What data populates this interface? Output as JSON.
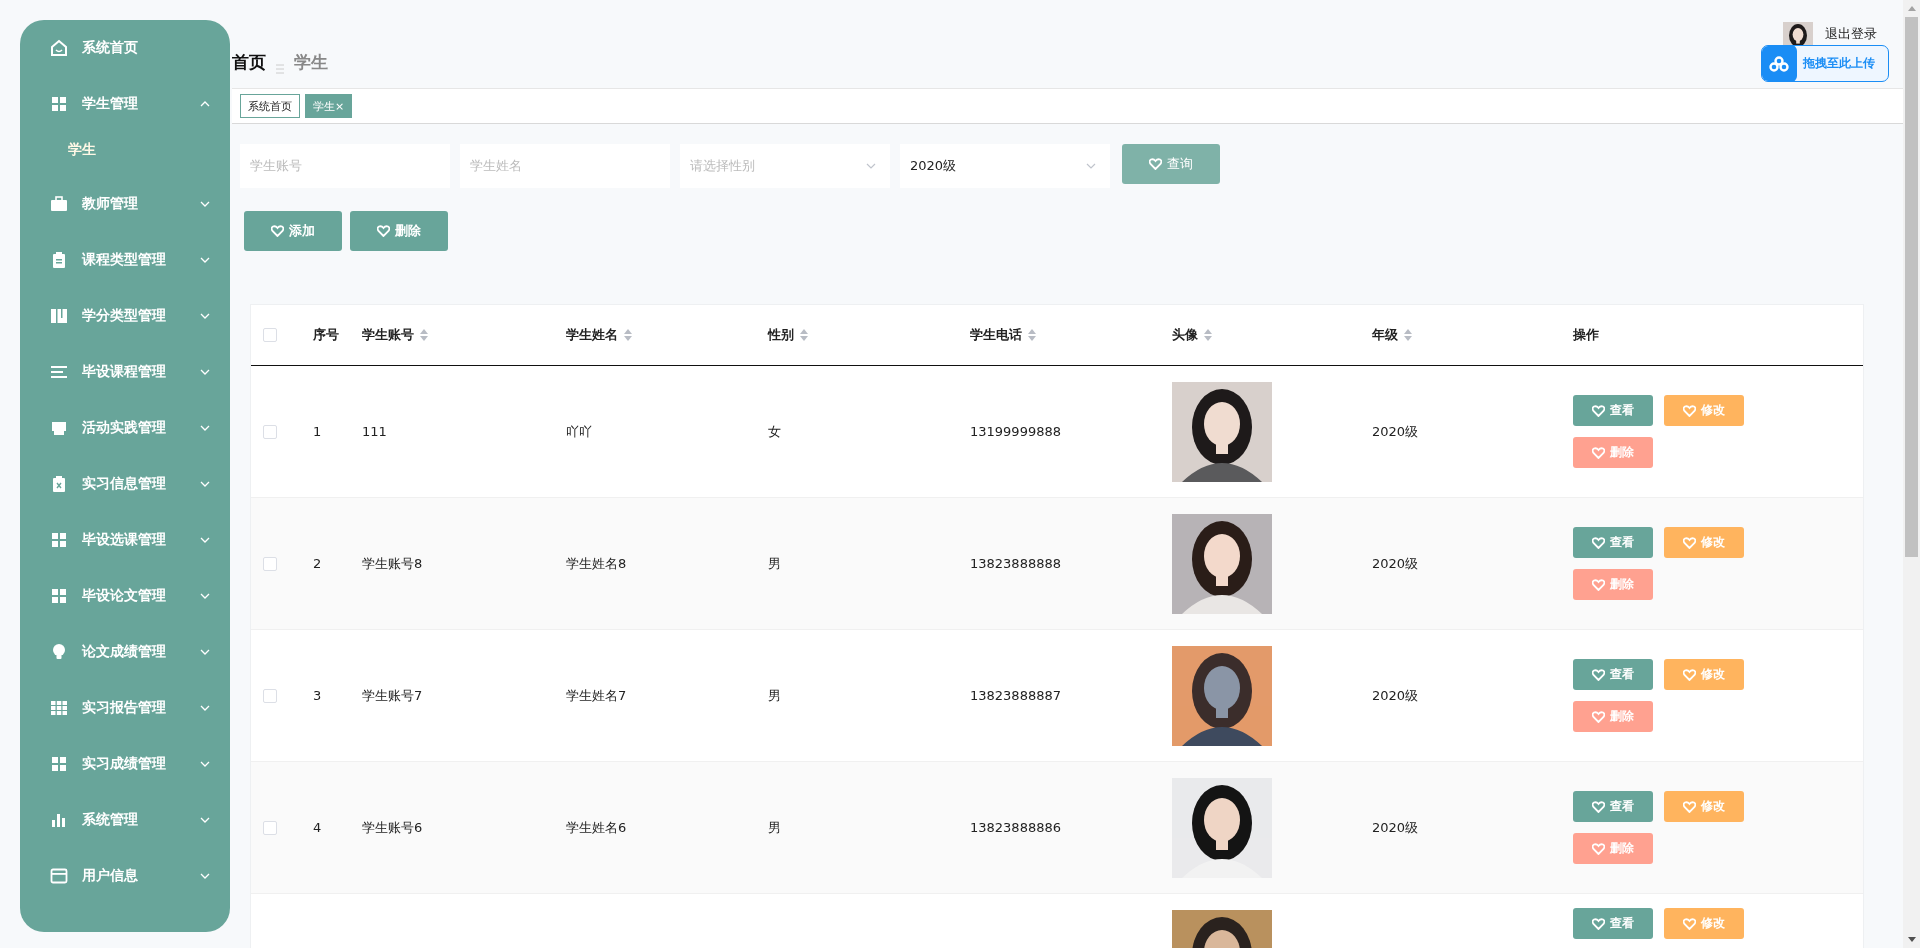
{
  "sidebar": {
    "items": [
      {
        "label": "系统首页",
        "expandable": false
      },
      {
        "label": "学生管理",
        "expanded": true,
        "children": [
          {
            "label": "学生"
          }
        ]
      },
      {
        "label": "教师管理",
        "expanded": false
      },
      {
        "label": "课程类型管理",
        "expanded": false
      },
      {
        "label": "学分类型管理",
        "expanded": false
      },
      {
        "label": "毕设课程管理",
        "expanded": false
      },
      {
        "label": "活动实践管理",
        "expanded": false
      },
      {
        "label": "实习信息管理",
        "expanded": false
      },
      {
        "label": "毕设选课管理",
        "expanded": false
      },
      {
        "label": "毕设论文管理",
        "expanded": false
      },
      {
        "label": "论文成绩管理",
        "expanded": false
      },
      {
        "label": "实习报告管理",
        "expanded": false
      },
      {
        "label": "实习成绩管理",
        "expanded": false
      },
      {
        "label": "系统管理",
        "expanded": false
      },
      {
        "label": "用户信息",
        "expanded": false
      }
    ]
  },
  "header": {
    "breadcrumb": [
      "首页",
      "学生"
    ],
    "logout": "退出登录",
    "upload_widget": "拖拽至此上传"
  },
  "tabs": [
    {
      "label": "系统首页",
      "selected": false
    },
    {
      "label": "学生",
      "close": "×",
      "selected": true
    }
  ],
  "filters": [
    {
      "kind": "input",
      "placeholder": "学生账号"
    },
    {
      "kind": "input",
      "placeholder": "学生姓名"
    },
    {
      "kind": "select",
      "placeholder": "请选择性别"
    },
    {
      "kind": "select",
      "value": "2020级"
    }
  ],
  "search_button": "查询",
  "actions": [
    "添加",
    "删除"
  ],
  "table": {
    "select_all_checked": false,
    "columns": [
      {
        "label": "序号",
        "sortable": false
      },
      {
        "label": "学生账号",
        "sortable": true
      },
      {
        "label": "学生姓名",
        "sortable": true
      },
      {
        "label": "性别",
        "sortable": true
      },
      {
        "label": "学生电话",
        "sortable": true
      },
      {
        "label": "头像",
        "sortable": true
      },
      {
        "label": "年级",
        "sortable": true
      },
      {
        "label": "操作",
        "sortable": false
      }
    ],
    "rows": [
      {
        "checked": false,
        "index": "1",
        "account": "111",
        "name": "吖吖",
        "gender": "女",
        "phone": "13199999888",
        "avatar": {
          "kind": "picture"
        },
        "grade": "2020级",
        "actions": [
          {
            "kind": "view",
            "label": "查看"
          },
          {
            "kind": "edit",
            "label": "修改"
          },
          {
            "kind": "delete",
            "label": "删除"
          }
        ]
      },
      {
        "checked": false,
        "index": "2",
        "account": "学生账号8",
        "name": "学生姓名8",
        "gender": "男",
        "phone": "13823888888",
        "avatar": {
          "kind": "picture"
        },
        "grade": "2020级",
        "actions": [
          {
            "kind": "view",
            "label": "查看"
          },
          {
            "kind": "edit",
            "label": "修改"
          },
          {
            "kind": "delete",
            "label": "删除"
          }
        ]
      },
      {
        "checked": false,
        "index": "3",
        "account": "学生账号7",
        "name": "学生姓名7",
        "gender": "男",
        "phone": "13823888887",
        "avatar": {
          "kind": "picture"
        },
        "grade": "2020级",
        "actions": [
          {
            "kind": "view",
            "label": "查看"
          },
          {
            "kind": "edit",
            "label": "修改"
          },
          {
            "kind": "delete",
            "label": "删除"
          }
        ]
      },
      {
        "checked": false,
        "index": "4",
        "account": "学生账号6",
        "name": "学生姓名6",
        "gender": "男",
        "phone": "13823888886",
        "avatar": {
          "kind": "picture"
        },
        "grade": "2020级",
        "actions": [
          {
            "kind": "view",
            "label": "查看"
          },
          {
            "kind": "edit",
            "label": "修改"
          },
          {
            "kind": "delete",
            "label": "删除"
          }
        ]
      },
      {
        "avatar": {
          "kind": "picture"
        },
        "actions": [
          {
            "kind": "view",
            "label": "查看"
          },
          {
            "kind": "edit",
            "label": "修改"
          }
        ]
      }
    ]
  }
}
